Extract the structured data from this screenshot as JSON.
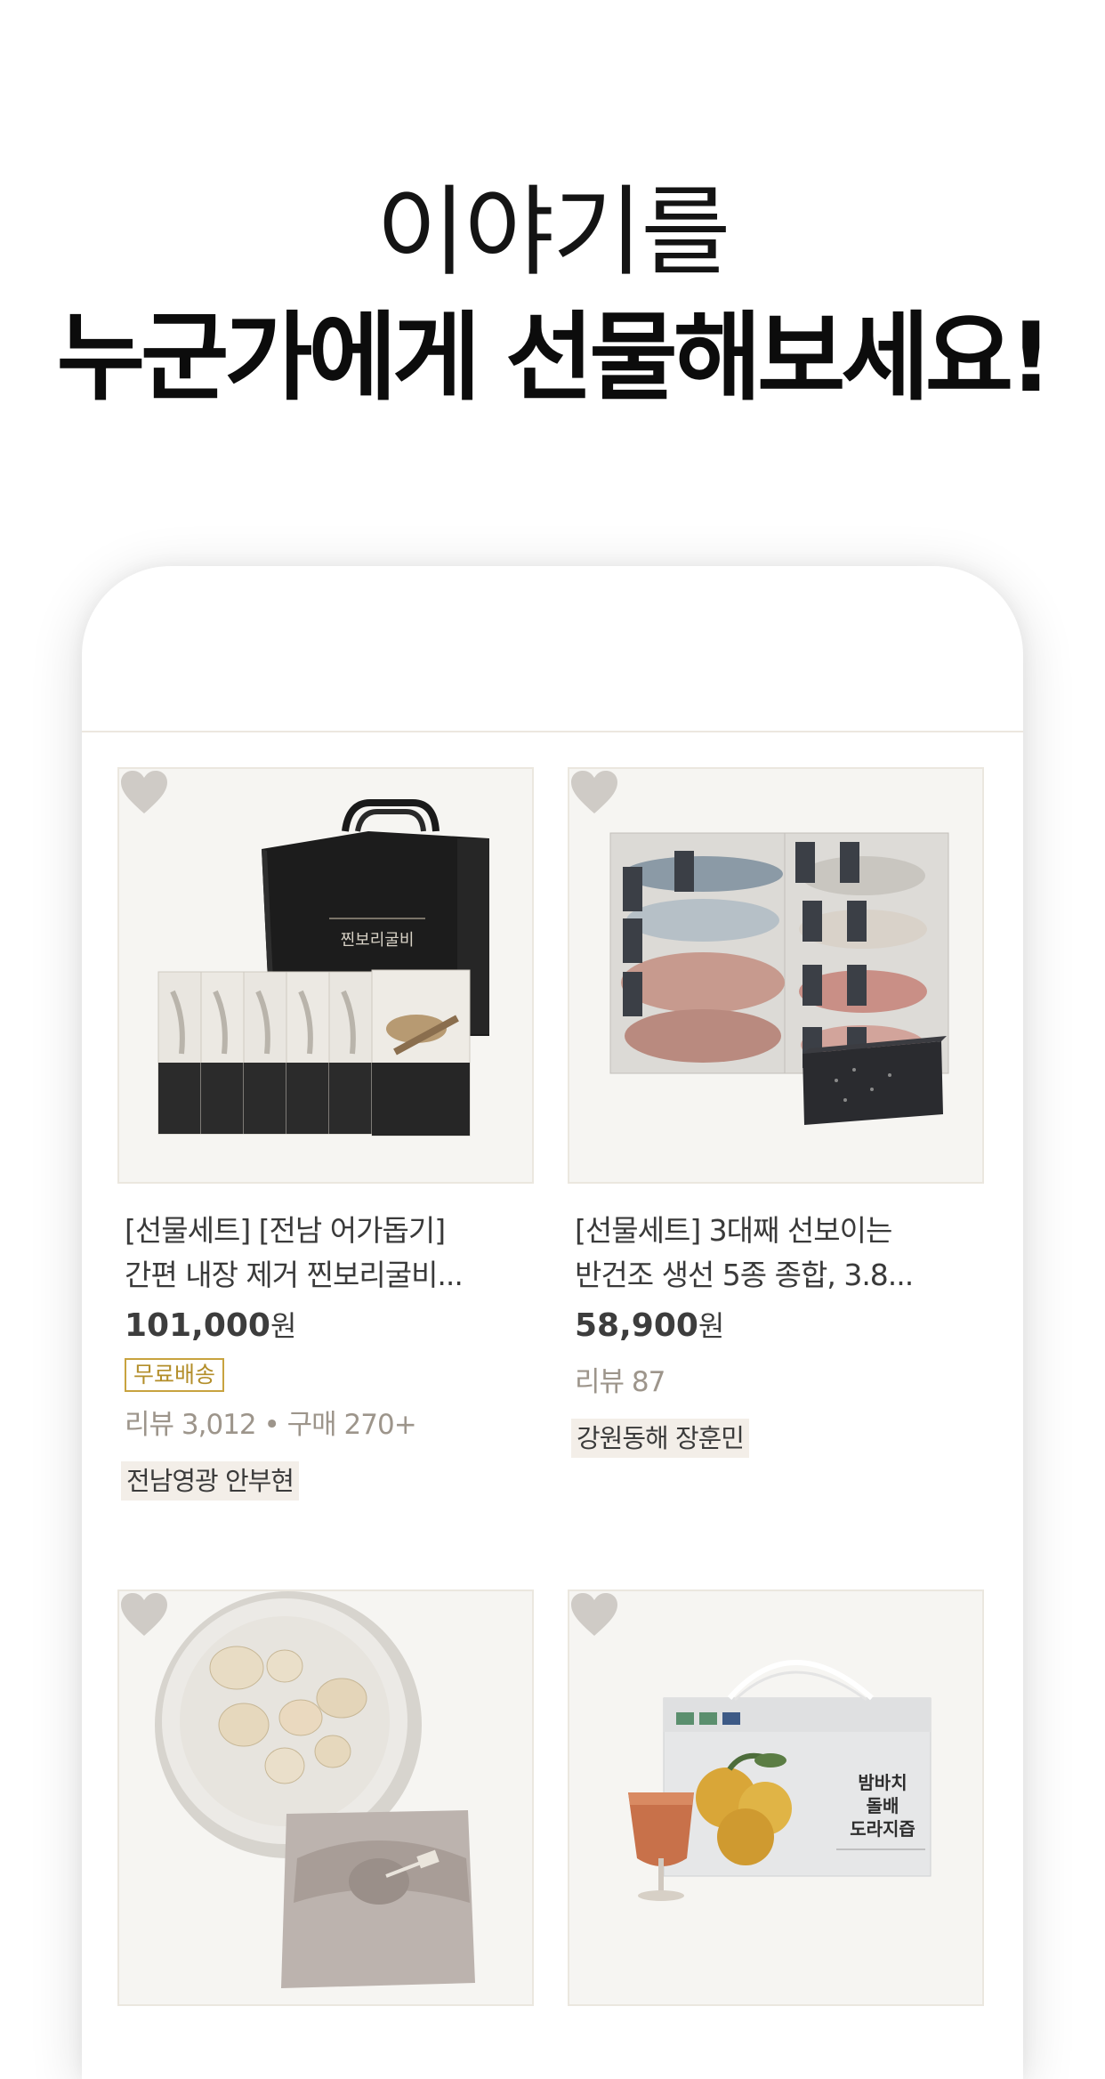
{
  "headline": {
    "line1": "이야기를",
    "line2": "누군가에게 선물해보세요!"
  },
  "products": [
    {
      "title_line1": "[선물세트] [전남 어가돕기]",
      "title_line2": "간편 내장 제거 찐보리굴비...",
      "price": "101,000",
      "currency": "원",
      "badge": "무료배송",
      "meta": "리뷰 3,012 • 구매 270+",
      "seller": "전남영광 안부현",
      "image": "boxed-dried-croaker-gift-set",
      "package_text": "찐보리굴비"
    },
    {
      "title_line1": "[선물세트] 3대째 선보이는",
      "title_line2": "반건조 생선 5종 종합, 3.8...",
      "price": "58,900",
      "currency": "원",
      "meta": "리뷰 87",
      "seller": "강원동해 장훈민",
      "image": "semi-dried-fish-assortment"
    },
    {
      "image": "rice-cakes-and-wrapped-gift",
      "title_line1": "",
      "title_line2": ""
    },
    {
      "image": "pear-bellflower-juice-box",
      "package_text": "밤바치\n돌배\n도라지즙"
    }
  ],
  "colors": {
    "badge": "#c8a33f",
    "seller_bg": "#f3eee8",
    "meta_text": "#9d958b",
    "heart": "#cfcbc6"
  },
  "icons": {
    "wishlist": "heart-icon"
  }
}
